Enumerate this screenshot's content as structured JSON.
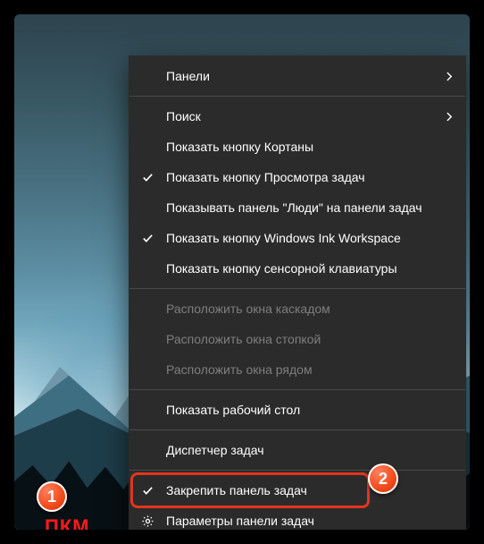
{
  "annotations": {
    "badge1": "1",
    "badge2": "2",
    "rcm_label": "ПКМ"
  },
  "menu": {
    "toolbars": "Панели",
    "search": "Поиск",
    "cortana_button": "Показать кнопку Кортаны",
    "task_view_button": "Показать кнопку Просмотра задач",
    "people_bar": "Показывать панель \"Люди\" на панели задач",
    "ink_workspace": "Показать кнопку Windows Ink Workspace",
    "touch_keyboard": "Показать кнопку сенсорной клавиатуры",
    "cascade": "Расположить окна каскадом",
    "stacked": "Расположить окна стопкой",
    "side_by_side": "Расположить окна рядом",
    "show_desktop": "Показать рабочий стол",
    "task_manager": "Диспетчер задач",
    "lock_taskbar": "Закрепить панель задач",
    "taskbar_settings": "Параметры панели задач"
  }
}
